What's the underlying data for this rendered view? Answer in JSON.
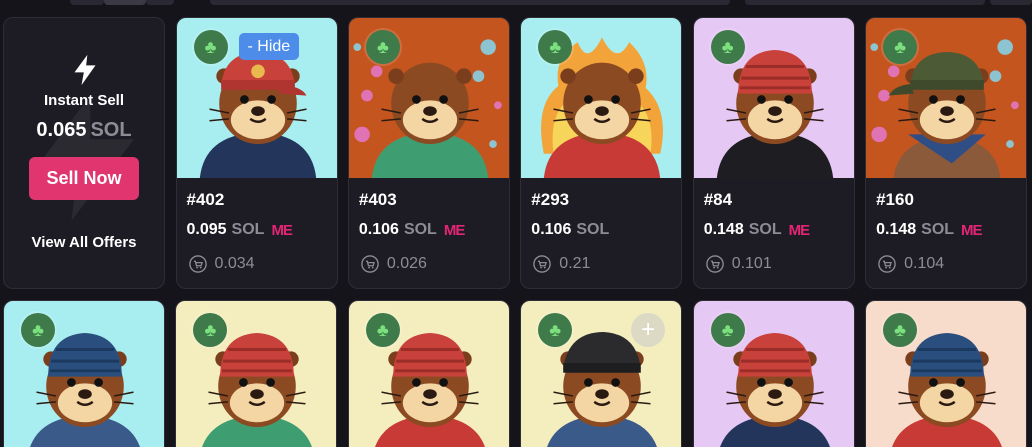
{
  "colors": {
    "page_bg": "#15141b",
    "card_bg": "#1d1c24",
    "accent_pink": "#e0356e",
    "hide_blue": "#4d8de9",
    "muted": "#8d8c96",
    "badge_green": "#3f7a4a",
    "magic_eden": "#e42575"
  },
  "instant_sell": {
    "title": "Instant Sell",
    "price": "0.065",
    "currency": "SOL",
    "button_label": "Sell Now",
    "view_all_label": "View All Offers",
    "icon": "lightning-bolt-icon"
  },
  "listings": [
    {
      "name": "#402",
      "price": "0.095",
      "currency": "SOL",
      "marketplace": "ME",
      "offer": "0.034",
      "bg": "#a8eef0",
      "hat": "cap-red",
      "outfit": "hoodie-navy",
      "action_label": "- Hide"
    },
    {
      "name": "#403",
      "price": "0.106",
      "currency": "SOL",
      "marketplace": "ME",
      "offer": "0.026",
      "bg": "#c4551f",
      "hat": "none",
      "outfit": "hoodie-green"
    },
    {
      "name": "#293",
      "price": "0.106",
      "currency": "SOL",
      "marketplace": "",
      "offer": "0.21",
      "bg": "#a8eef0",
      "hat": "flames",
      "outfit": "hoodie-red"
    },
    {
      "name": "#84",
      "price": "0.148",
      "currency": "SOL",
      "marketplace": "ME",
      "offer": "0.101",
      "bg": "#e5c8f4",
      "hat": "beanie-red",
      "outfit": "tee-black"
    },
    {
      "name": "#160",
      "price": "0.148",
      "currency": "SOL",
      "marketplace": "ME",
      "offer": "0.104",
      "bg": "#c4551f",
      "hat": "cap-green",
      "outfit": "bandana-blue"
    }
  ],
  "row2": [
    {
      "bg": "#a8eef0",
      "hat": "beanie-navy"
    },
    {
      "bg": "#f4eebe",
      "hat": "beanie-red"
    },
    {
      "bg": "#f4eebe",
      "hat": "beanie-red"
    },
    {
      "bg": "#f4eebe",
      "hat": "cap-black",
      "action_symbol": "+"
    },
    {
      "bg": "#e5c8f4",
      "hat": "beanie-red"
    },
    {
      "bg": "#f7dccb",
      "hat": "beanie-navy"
    }
  ],
  "icons": {
    "badge": "clover-icon",
    "offer": "cart-icon"
  }
}
